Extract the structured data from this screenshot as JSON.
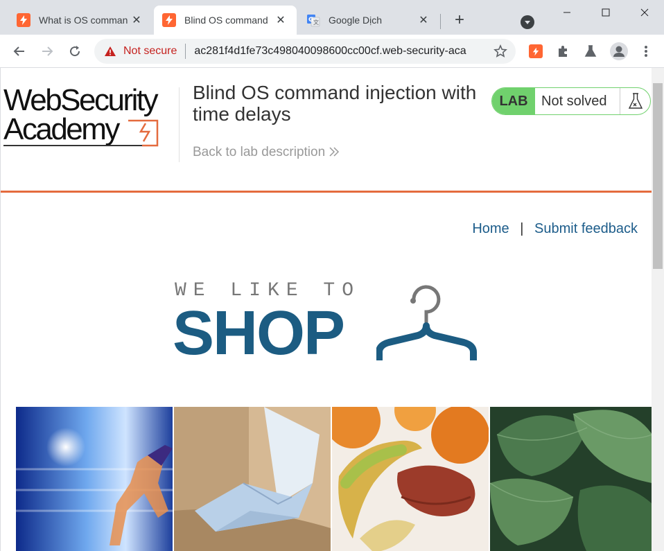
{
  "browser": {
    "tabs": [
      {
        "title": "What is OS comman",
        "active": false
      },
      {
        "title": "Blind OS command",
        "active": true
      },
      {
        "title": "Google Dịch",
        "active": false
      }
    ],
    "address": {
      "security_label": "Not secure",
      "url": "ac281f4d1fe73c498040098600cc00cf.web-security-aca"
    }
  },
  "header": {
    "logo_line1": "WebSecurity",
    "logo_line2": "Academy",
    "lab_title": "Blind OS command injection with time delays",
    "back_link": "Back to lab description",
    "badge": {
      "lab": "LAB",
      "status": "Not solved"
    }
  },
  "nav": {
    "home": "Home",
    "separator": "|",
    "feedback": "Submit feedback"
  },
  "banner": {
    "line1": "WE LIKE TO",
    "line2": "SHOP"
  },
  "colors": {
    "brand_orange": "#e46b3e",
    "lab_green": "#70d16d",
    "link_blue": "#1c5c8a",
    "shop_blue": "#1c5c82"
  }
}
